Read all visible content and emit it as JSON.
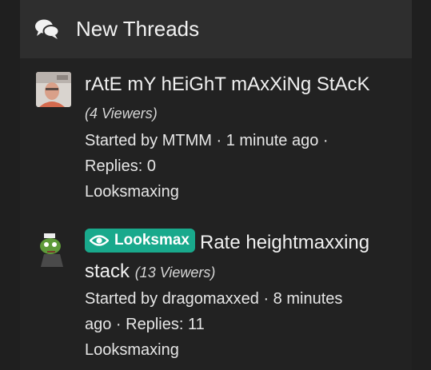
{
  "header": {
    "title": "New Threads",
    "icon": "comments-icon"
  },
  "threads": [
    {
      "title": "rAtE mY hEiGhT mAxXiNg StAcK",
      "viewers": "(4 Viewers)",
      "meta_line1": "Started by MTMM · 1 minute ago ·",
      "meta_line2": "Replies: 0",
      "forum": "Looksmaxing"
    },
    {
      "prefix": "Looksmax",
      "title_line1": "Rate heightmaxxing",
      "title_line2": "stack",
      "viewers": "(13 Viewers)",
      "meta_line1": "Started by dragomaxxed · 8 minutes",
      "meta_line2": "ago · Replies: 11",
      "forum": "Looksmaxing"
    }
  ],
  "colors": {
    "prefix_bg": "#19a98c",
    "header_bg": "#2e2e2e",
    "panel_bg": "#222222"
  }
}
